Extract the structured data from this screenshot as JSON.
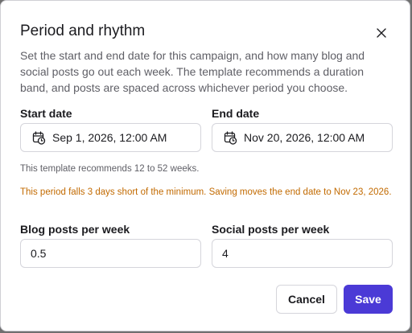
{
  "dialog": {
    "title": "Period and rhythm",
    "description": "Set the start and end date for this campaign, and how many blog and social posts go out each week. The template recommends a duration band, and posts are spaced across whichever period you choose.",
    "start_date": {
      "label": "Start date",
      "value": "Sep 1, 2026, 12:00 AM"
    },
    "end_date": {
      "label": "End date",
      "value": "Nov 20, 2026, 12:00 AM"
    },
    "recommendation": "This template recommends 12 to 52 weeks.",
    "warning": "This period falls 3 days short of the minimum. Saving moves the end date to Nov 23, 2026.",
    "blog_posts": {
      "label": "Blog posts per week",
      "value": "0.5"
    },
    "social_posts": {
      "label": "Social posts per week",
      "value": "4"
    },
    "cancel_label": "Cancel",
    "save_label": "Save"
  },
  "icons": {
    "close": "close-icon",
    "calendar": "calendar-clock-icon"
  },
  "colors": {
    "accent": "#4b3ad6",
    "warning": "#c26a00"
  }
}
